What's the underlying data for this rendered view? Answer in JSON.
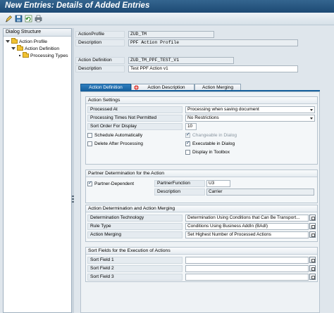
{
  "window": {
    "title": "New Entries: Details of Added Entries"
  },
  "toolbar": {
    "icons": [
      "edit-icon",
      "save-icon",
      "undo-icon",
      "print-icon"
    ]
  },
  "tree": {
    "heading": "Dialog Structure",
    "nodes": [
      "Action Profile",
      "Action Definition",
      "Processing Types"
    ]
  },
  "header": {
    "profile_label": "ActionProfile",
    "profile_value": "ZUD_TM",
    "profile_desc_label": "Description",
    "profile_desc_value": "PPF Action Profile",
    "def_label": "Action Definition",
    "def_value": "ZUD_TM_PPF_TEST_V1",
    "def_desc_label": "Description",
    "def_desc_value": "Test PPF Action v1"
  },
  "tabs": [
    "Action Definition",
    "Action Description",
    "Action Merging"
  ],
  "settings": {
    "title": "Action Settings",
    "processed_at_label": "Processed At",
    "processed_at_value": "Processing when saving document",
    "proc_times_label": "Processing Times Not Permitted",
    "proc_times_value": "No Restrictions",
    "sort_order_label": "Sort Order For Display",
    "sort_order_value": "10",
    "schedule_auto": "Schedule Automatically",
    "changeable_dialog": "Changeable in Dialog",
    "delete_after": "Delete After Processing",
    "executable_dialog": "Executable in Dialog",
    "display_toolbox": "Display in Toolbox"
  },
  "partner": {
    "title": "Partner Determination for the Action",
    "partner_dependent": "Partner-Dependent",
    "function_label": "PartnerFunction",
    "function_value": "U3",
    "desc_label": "Description",
    "desc_value": "Carrier"
  },
  "determination": {
    "title": "Action Determination and Action Merging",
    "tech_label": "Determination Technology",
    "tech_value": "Determination Using Conditions that Can Be Transport...",
    "rule_label": "Rule Type",
    "rule_value": "Conditions Using Business AddIn (BAdI)",
    "merging_label": "Action Merging",
    "merging_value": "Set Highest Number of Processed Actions"
  },
  "sort_fields": {
    "title": "Sort Fields for the Execution of Actions",
    "field1": "Sort Field 1",
    "field2": "Sort Field 2",
    "field3": "Sort Field 3"
  }
}
